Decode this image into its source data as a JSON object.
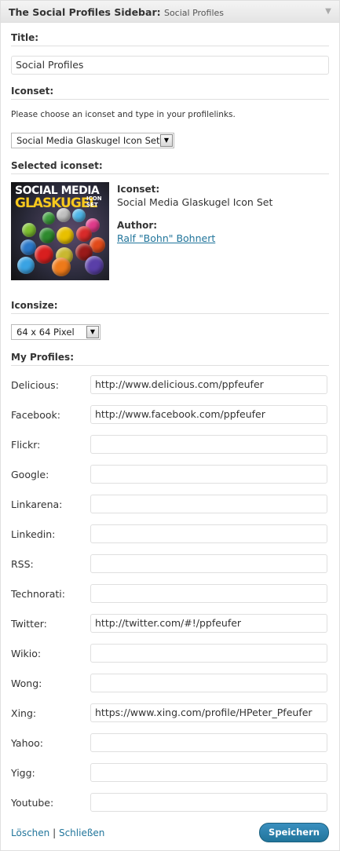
{
  "widget": {
    "title": "The Social Profiles Sidebar",
    "title_sep": ":",
    "subtitle": "Social Profiles"
  },
  "title_section": {
    "label": "Title:",
    "value": "Social Profiles"
  },
  "iconset_section": {
    "label": "Iconset:",
    "hint": "Please choose an iconset and type in your profilelinks.",
    "selected_value": "Social Media Glaskugel Icon Set"
  },
  "selected_iconset": {
    "label": "Selected iconset:",
    "image_text_line1": "SOCIAL MEDIA",
    "image_text_line2": "GLASKUGEL",
    "image_text_badge": "ICON SET",
    "iconset_label": "Iconset:",
    "iconset_name": "Social Media Glaskugel Icon Set",
    "author_label": "Author:",
    "author_name": "Ralf \"Bohn\" Bohnert"
  },
  "iconsize": {
    "label": "Iconsize:",
    "selected_value": "64 x 64 Pixel"
  },
  "profiles": {
    "label": "My Profiles:",
    "items": [
      {
        "name": "Delicious:",
        "value": "http://www.delicious.com/ppfeufer"
      },
      {
        "name": "Facebook:",
        "value": "http://www.facebook.com/ppfeufer"
      },
      {
        "name": "Flickr:",
        "value": ""
      },
      {
        "name": "Google:",
        "value": ""
      },
      {
        "name": "Linkarena:",
        "value": ""
      },
      {
        "name": "Linkedin:",
        "value": ""
      },
      {
        "name": "RSS:",
        "value": ""
      },
      {
        "name": "Technorati:",
        "value": ""
      },
      {
        "name": "Twitter:",
        "value": "http://twitter.com/#!/ppfeufer"
      },
      {
        "name": "Wikio:",
        "value": ""
      },
      {
        "name": "Wong:",
        "value": ""
      },
      {
        "name": "Xing:",
        "value": "https://www.xing.com/profile/HPeter_Pfeufer"
      },
      {
        "name": "Yahoo:",
        "value": ""
      },
      {
        "name": "Yigg:",
        "value": ""
      },
      {
        "name": "Youtube:",
        "value": ""
      }
    ]
  },
  "footer": {
    "delete_label": "Löschen",
    "separator": "|",
    "close_label": "Schließen",
    "save_label": "Speichern"
  },
  "colors": {
    "link": "#21759b",
    "button": "#21759b"
  },
  "icons": {
    "collapse": "triangle-down-icon",
    "dropdown": "triangle-down-icon"
  }
}
